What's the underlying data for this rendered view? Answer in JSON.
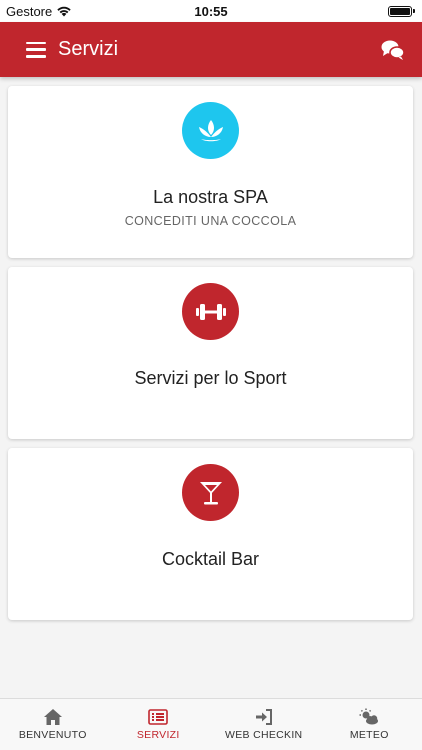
{
  "status_bar": {
    "carrier": "Gestore",
    "time": "10:55"
  },
  "header": {
    "title": "Servizi",
    "menu_icon": "hamburger-menu-icon",
    "action_icon": "chat-bubbles-icon"
  },
  "colors": {
    "primary": "#c0262d",
    "spa": "#1ec6ee",
    "sport": "#c0262d",
    "bar": "#c0262d"
  },
  "cards": [
    {
      "title": "La nostra SPA",
      "subtitle": "CONCEDITI UNA COCCOLA",
      "icon": "lotus-icon"
    },
    {
      "title": "Servizi per lo Sport",
      "subtitle": "",
      "icon": "dumbbell-icon"
    },
    {
      "title": "Cocktail Bar",
      "subtitle": "",
      "icon": "cocktail-glass-icon"
    }
  ],
  "tabs": [
    {
      "label": "BENVENUTO",
      "icon": "home-icon",
      "active": false
    },
    {
      "label": "SERVIZI",
      "icon": "list-icon",
      "active": true
    },
    {
      "label": "WEB CHECKIN",
      "icon": "sign-in-icon",
      "active": false
    },
    {
      "label": "METEO",
      "icon": "weather-icon",
      "active": false
    }
  ]
}
